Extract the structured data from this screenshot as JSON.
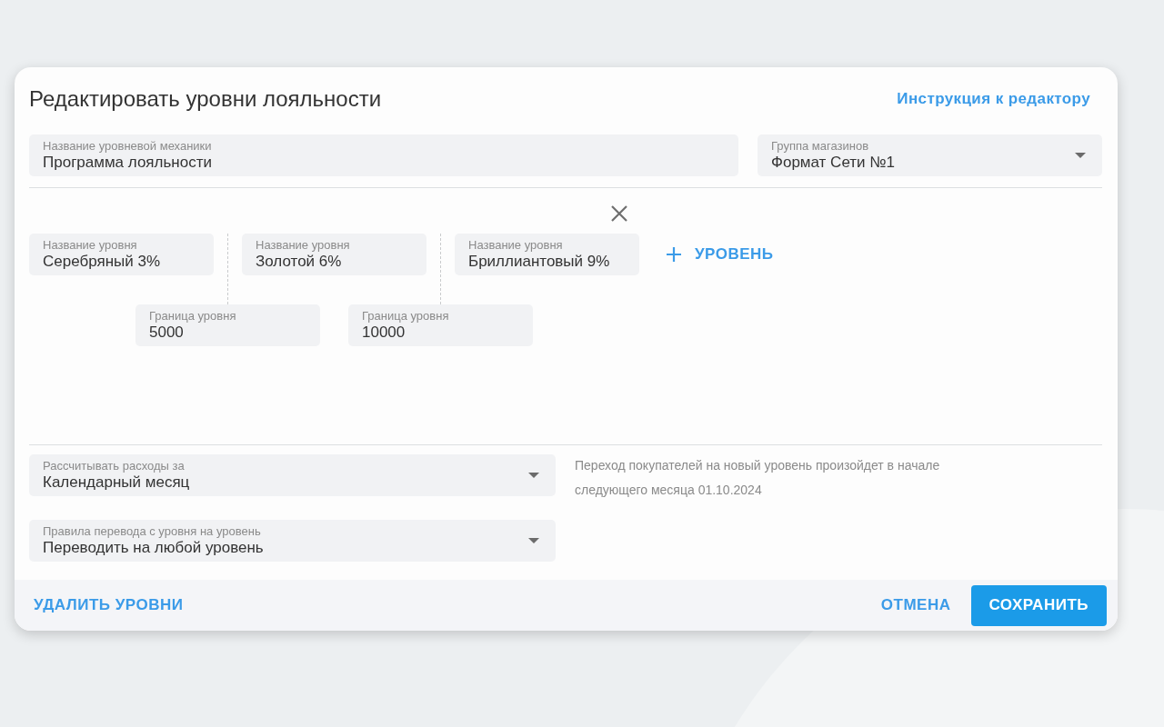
{
  "dialog": {
    "title": "Редактировать уровни лояльности",
    "help_link": "Инструкция к редактору"
  },
  "fields": [
    {
      "kind": "text",
      "label": "Название уровневой механики",
      "value": "Программа лояльности"
    },
    {
      "kind": "select",
      "label": "Группа магазинов",
      "value": "Формат Сети №1"
    }
  ],
  "levels": [
    {
      "label": "Название уровня",
      "value": "Серебряный 3%"
    },
    {
      "label": "Название уровня",
      "value": "Золотой 6%"
    },
    {
      "label": "Название уровня",
      "value": "Бриллиантовый 9%"
    }
  ],
  "boundaries": [
    {
      "label": "Граница уровня",
      "value": "5000"
    },
    {
      "label": "Граница уровня",
      "value": "10000"
    }
  ],
  "add_level_button": "УРОВЕНЬ",
  "settings": [
    {
      "kind": "select",
      "label": "Рассчитывать расходы за",
      "value": "Календарный месяц"
    },
    {
      "kind": "select",
      "label": "Правила перевода с уровня на уровень",
      "value": "Переводить на любой уровень"
    }
  ],
  "note": "Переход покупателей на новый уровень произойдет в начале следующего месяца 01.10.2024",
  "footer": {
    "delete_button": "УДАЛИТЬ УРОВНИ",
    "cancel_button": "ОТМЕНА",
    "save_button": "СОХРАНИТЬ"
  }
}
